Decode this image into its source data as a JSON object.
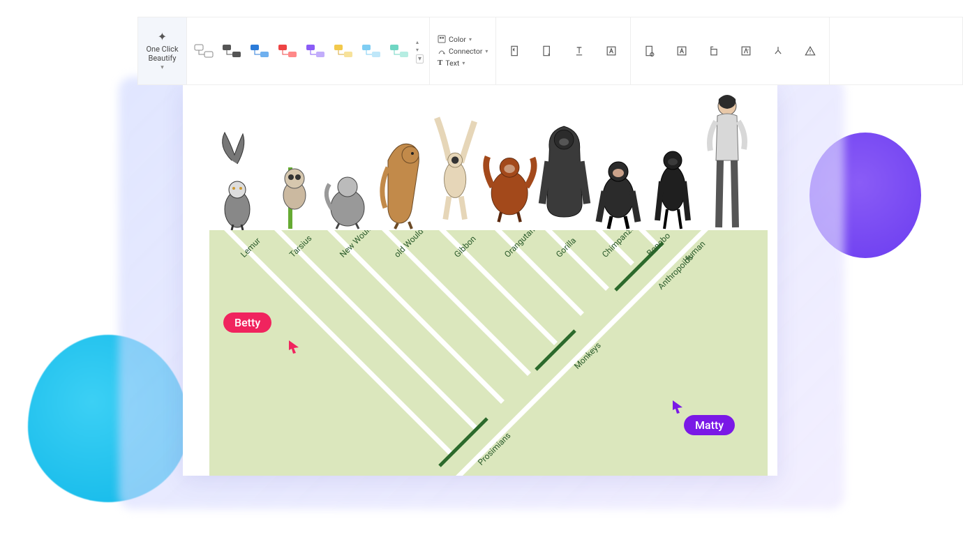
{
  "toolbar": {
    "beautify_line1": "One Click",
    "beautify_line2": "Beautify",
    "color_label": "Color",
    "connector_label": "Connector",
    "text_label": "Text"
  },
  "cladogram": {
    "species": [
      "Lemur",
      "Tarsius",
      "New Would monkeys",
      "old Would monkeys",
      "Gibbon",
      "Orangutan",
      "Gorilla",
      "Chimpanzee",
      "Bonobo",
      "Human"
    ],
    "groups": [
      "Prosimians",
      "Monkeys",
      "Anthropoids"
    ]
  },
  "cursors": {
    "betty": "Betty",
    "matty": "Matty"
  }
}
